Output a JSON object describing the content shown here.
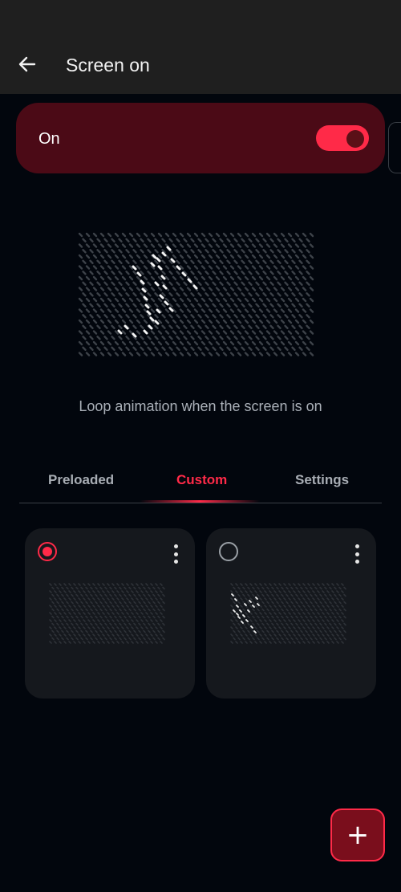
{
  "header": {
    "title": "Screen on",
    "back_icon": "arrow-left-icon"
  },
  "toggle": {
    "label": "On",
    "state": "on",
    "accent": "#ff2a48",
    "card_color": "#4b0a16"
  },
  "preview": {
    "caption": "Loop animation when the screen is on"
  },
  "tabs": [
    {
      "label": "Preloaded",
      "active": false
    },
    {
      "label": "Custom",
      "active": true
    },
    {
      "label": "Settings",
      "active": false
    }
  ],
  "cards": [
    {
      "selected": true,
      "menu_icon": "more-vertical-icon",
      "thumbnail": "empty-dot-matrix"
    },
    {
      "selected": false,
      "menu_icon": "more-vertical-icon",
      "thumbnail": "logo-dot-matrix"
    }
  ],
  "fab": {
    "icon": "plus-icon",
    "glyph": "+"
  },
  "colors": {
    "background": "#02060d",
    "bar": "#1f1f1f",
    "accent": "#ff2a48",
    "card": "#15181d"
  }
}
